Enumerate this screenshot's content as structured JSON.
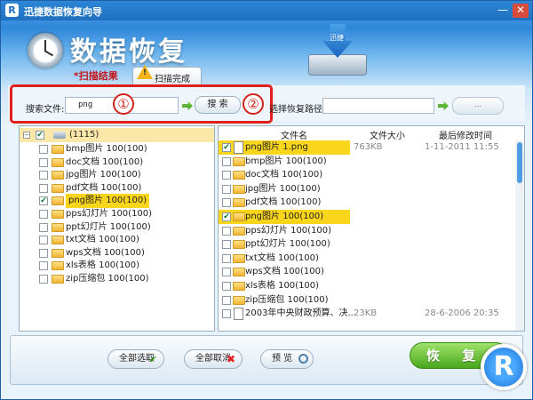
{
  "window": {
    "title": "迅捷数据恢复向导",
    "app_icon_letter": "R",
    "minimize_glyph": "—",
    "close_glyph": "✕"
  },
  "header": {
    "heading": "数据恢复",
    "drive_label": "迅捷"
  },
  "tabs": {
    "active_label": "*扫描结果",
    "next_label": "扫描完成",
    "warning_glyph": "!"
  },
  "search": {
    "label": "搜索文件:",
    "value": "png",
    "button_label": "搜 索",
    "path_label": "选择恢复路径",
    "path_value": "",
    "browse_label": "...",
    "callout_1": "①",
    "callout_2": "②"
  },
  "tree": {
    "root": {
      "label": "(1115)",
      "checked": true,
      "expander": "−"
    },
    "items": [
      {
        "label": "bmp图片 100(100)",
        "checked": false,
        "selected": false
      },
      {
        "label": "doc文档 100(100)",
        "checked": false,
        "selected": false
      },
      {
        "label": "jpg图片 100(100)",
        "checked": false,
        "selected": false
      },
      {
        "label": "pdf文档 100(100)",
        "checked": false,
        "selected": false
      },
      {
        "label": "png图片 100(100)",
        "checked": true,
        "selected": true
      },
      {
        "label": "pps幻灯片 100(100)",
        "checked": false,
        "selected": false
      },
      {
        "label": "ppt幻灯片 100(100)",
        "checked": false,
        "selected": false
      },
      {
        "label": "txt文档 100(100)",
        "checked": false,
        "selected": false
      },
      {
        "label": "wps文档 100(100)",
        "checked": false,
        "selected": false
      },
      {
        "label": "xls表格 100(100)",
        "checked": false,
        "selected": false
      },
      {
        "label": "zip压缩包 100(100)",
        "checked": false,
        "selected": false
      }
    ]
  },
  "list": {
    "columns": {
      "name": "文件名",
      "size": "文件大小",
      "modified": "最后修改时间"
    },
    "rows": [
      {
        "name": "png图片 1.png",
        "size": "763KB",
        "date": "1-11-2011 11:55",
        "checked": true,
        "selected": true,
        "type": "file"
      },
      {
        "name": "bmp图片 100(100)",
        "size": "",
        "date": "",
        "checked": false,
        "selected": false,
        "type": "folder"
      },
      {
        "name": "doc文档 100(100)",
        "size": "",
        "date": "",
        "checked": false,
        "selected": false,
        "type": "folder"
      },
      {
        "name": "jpg图片 100(100)",
        "size": "",
        "date": "",
        "checked": false,
        "selected": false,
        "type": "folder"
      },
      {
        "name": "pdf文档 100(100)",
        "size": "",
        "date": "",
        "checked": false,
        "selected": false,
        "type": "folder"
      },
      {
        "name": "png图片 100(100)",
        "size": "",
        "date": "",
        "checked": true,
        "selected": true,
        "type": "folder"
      },
      {
        "name": "pps幻灯片 100(100)",
        "size": "",
        "date": "",
        "checked": false,
        "selected": false,
        "type": "folder"
      },
      {
        "name": "ppt幻灯片 100(100)",
        "size": "",
        "date": "",
        "checked": false,
        "selected": false,
        "type": "folder"
      },
      {
        "name": "txt文档 100(100)",
        "size": "",
        "date": "",
        "checked": false,
        "selected": false,
        "type": "folder"
      },
      {
        "name": "wps文档 100(100)",
        "size": "",
        "date": "",
        "checked": false,
        "selected": false,
        "type": "folder"
      },
      {
        "name": "xls表格 100(100)",
        "size": "",
        "date": "",
        "checked": false,
        "selected": false,
        "type": "folder"
      },
      {
        "name": "zip压缩包 100(100)",
        "size": "",
        "date": "",
        "checked": false,
        "selected": false,
        "type": "folder"
      },
      {
        "name": "2003年中央财政预算、决...",
        "size": "23KB",
        "date": "28-6-2006 20:35",
        "checked": false,
        "selected": false,
        "type": "file"
      }
    ]
  },
  "footer": {
    "select_all": "全部选取",
    "deselect_all": "全部取消",
    "preview": "预 览",
    "recover": "恢 复",
    "select_all_glyph": "✔",
    "deselect_all_glyph": "✖"
  },
  "logo": {
    "letter": "R"
  },
  "colors": {
    "accent": "#2e86d6",
    "selection": "#f9d61c",
    "callout": "#e0201c",
    "recover_button": "#49a71c"
  }
}
